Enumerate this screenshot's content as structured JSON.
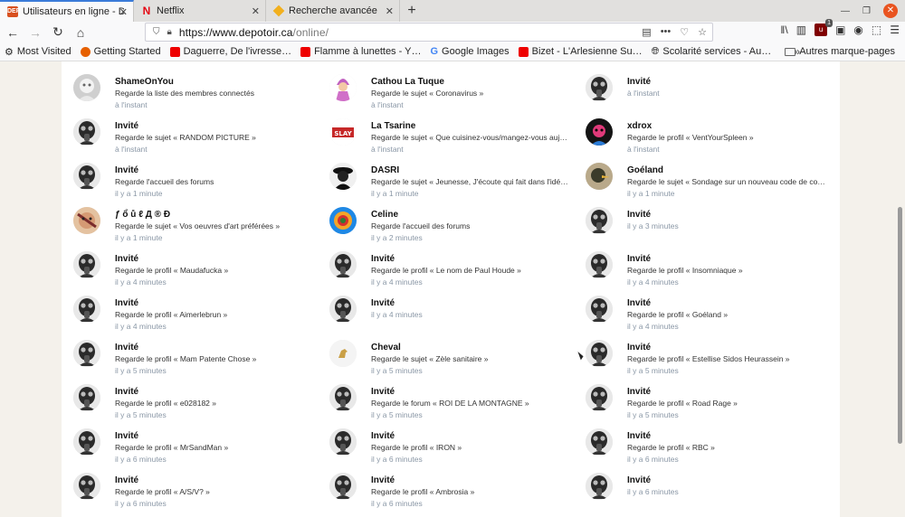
{
  "browser": {
    "tabs": [
      {
        "title": "Utilisateurs en ligne - DE",
        "active": true,
        "favicon": "depotoir-icon"
      },
      {
        "title": "Netflix",
        "active": false,
        "favicon": "netflix-icon"
      },
      {
        "title": "Recherche avancée",
        "active": false,
        "favicon": "search-site-icon"
      }
    ],
    "url_host": "https://www.depotoir.ca",
    "url_path": "/online/",
    "extension_badge": "1",
    "bookmarks": [
      {
        "label": "Most Visited",
        "icon": "gear-icon"
      },
      {
        "label": "Getting Started",
        "icon": "firefox-icon"
      },
      {
        "label": "Daguerre, De l'ivresse…",
        "icon": "youtube-icon"
      },
      {
        "label": "Flamme à lunettes - Y…",
        "icon": "youtube-icon"
      },
      {
        "label": "Google Images",
        "icon": "google-icon"
      },
      {
        "label": "Bizet - L'Arlesienne Su…",
        "icon": "youtube-icon"
      },
      {
        "label": "Scolarité services - Au…",
        "icon": "globe-icon"
      }
    ],
    "other_bookmarks": "Autres marque-pages"
  },
  "colors": {
    "accent": "#3b7bd9",
    "time": "#8a97a6",
    "close": "#e95420"
  },
  "users": [
    {
      "name": "ShameOnYou",
      "action": "Regarde la liste des membres connectés",
      "time": "à l'instant",
      "avatar": "ghost"
    },
    {
      "name": "Cathou La Tuque",
      "action": "Regarde le sujet « Coronavirus »",
      "time": "à l'instant",
      "avatar": "pink"
    },
    {
      "name": "Invité",
      "action": "",
      "time": "à l'instant",
      "avatar": "gasmask"
    },
    {
      "name": "Invité",
      "action": "Regarde le sujet « RANDOM PICTURE »",
      "time": "à l'instant",
      "avatar": "gasmask"
    },
    {
      "name": "La Tsarine",
      "action": "Regarde le sujet « Que cuisinez-vous/mangez-vous aujo…",
      "time": "à l'instant",
      "avatar": "red"
    },
    {
      "name": "xdrox",
      "action": "Regarde le profil « VentYourSpleen »",
      "time": "à l'instant",
      "avatar": "dark"
    },
    {
      "name": "Invité",
      "action": "Regarde l'accueil des forums",
      "time": "il y a 1 minute",
      "avatar": "gasmask"
    },
    {
      "name": "DASRI",
      "action": "Regarde le sujet « Jeunesse, J'écoute qui fait dans l'idéol…",
      "time": "il y a 1 minute",
      "avatar": "bw"
    },
    {
      "name": "Goéland",
      "action": "Regarde le sujet « Sondage sur un nouveau code de con…",
      "time": "il y a 1 minute",
      "avatar": "bird"
    },
    {
      "name": "ƒ ổ ů ℓ Д ® Ð",
      "action": "Regarde le sujet « Vos oeuvres d'art préférées »",
      "time": "il y a 1 minute",
      "avatar": "face"
    },
    {
      "name": "Celine",
      "action": "Regarde l'accueil des forums",
      "time": "il y a 2 minutes",
      "avatar": "colorful"
    },
    {
      "name": "Invité",
      "action": "",
      "time": "il y a 3 minutes",
      "avatar": "gasmask"
    },
    {
      "name": "Invité",
      "action": "Regarde le profil « Maudafucka »",
      "time": "il y a 4 minutes",
      "avatar": "gasmask"
    },
    {
      "name": "Invité",
      "action": "Regarde le profil « Le nom de Paul Houde »",
      "time": "il y a 4 minutes",
      "avatar": "gasmask"
    },
    {
      "name": "Invité",
      "action": "Regarde le profil « Insomniaque »",
      "time": "il y a 4 minutes",
      "avatar": "gasmask"
    },
    {
      "name": "Invité",
      "action": "Regarde le profil « Aimerlebrun »",
      "time": "il y a 4 minutes",
      "avatar": "gasmask"
    },
    {
      "name": "Invité",
      "action": "",
      "time": "il y a 4 minutes",
      "avatar": "gasmask"
    },
    {
      "name": "Invité",
      "action": "Regarde le profil « Goéland »",
      "time": "il y a 4 minutes",
      "avatar": "gasmask"
    },
    {
      "name": "Invité",
      "action": "Regarde le profil « Mam Patente Chose »",
      "time": "il y a 5 minutes",
      "avatar": "gasmask"
    },
    {
      "name": "Cheval",
      "action": "Regarde le sujet « Zèle sanitaire »",
      "time": "il y a 5 minutes",
      "avatar": "horse"
    },
    {
      "name": "Invité",
      "action": "Regarde le profil « Estellise Sidos Heurassein »",
      "time": "il y a 5 minutes",
      "avatar": "gasmask"
    },
    {
      "name": "Invité",
      "action": "Regarde le profil « e028182 »",
      "time": "il y a 5 minutes",
      "avatar": "gasmask"
    },
    {
      "name": "Invité",
      "action": "Regarde le forum « ROI DE LA MONTAGNE »",
      "time": "il y a 5 minutes",
      "avatar": "gasmask"
    },
    {
      "name": "Invité",
      "action": "Regarde le profil « Road Rage »",
      "time": "il y a 5 minutes",
      "avatar": "gasmask"
    },
    {
      "name": "Invité",
      "action": "Regarde le profil « MrSandMan »",
      "time": "il y a 6 minutes",
      "avatar": "gasmask"
    },
    {
      "name": "Invité",
      "action": "Regarde le profil « IRON »",
      "time": "il y a 6 minutes",
      "avatar": "gasmask"
    },
    {
      "name": "Invité",
      "action": "Regarde le profil « RBC »",
      "time": "il y a 6 minutes",
      "avatar": "gasmask"
    },
    {
      "name": "Invité",
      "action": "Regarde le profil « A/S/V? »",
      "time": "il y a 6 minutes",
      "avatar": "gasmask"
    },
    {
      "name": "Invité",
      "action": "Regarde le profil « Ambrosia »",
      "time": "il y a 6 minutes",
      "avatar": "gasmask"
    },
    {
      "name": "Invité",
      "action": "",
      "time": "il y a 6 minutes",
      "avatar": "gasmask"
    }
  ]
}
